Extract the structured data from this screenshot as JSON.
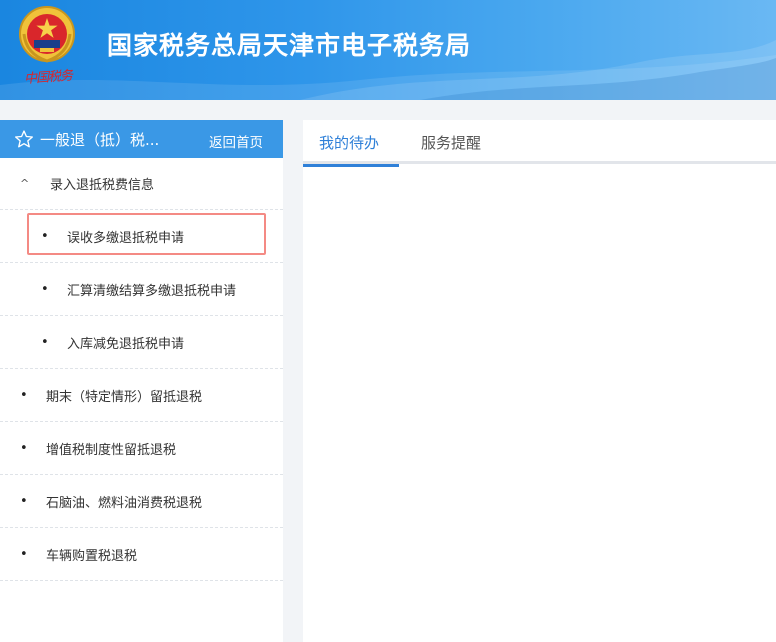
{
  "header": {
    "title": "国家税务总局天津市电子税务局",
    "signature": "中国税务",
    "emblem_icon": "tax-emblem-icon",
    "brand_color": "#1a86e0"
  },
  "sidebar": {
    "title": "一般退（抵）税...",
    "home_label": "返回首页",
    "star_icon": "star-icon",
    "group": {
      "marker": "^",
      "label": "录入退抵税费信息",
      "items": [
        {
          "label": "误收多缴退抵税申请"
        },
        {
          "label": "汇算清缴结算多缴退抵税申请"
        },
        {
          "label": "入库减免退抵税申请"
        }
      ]
    },
    "items": [
      {
        "label": "期末（特定情形）留抵退税"
      },
      {
        "label": "增值税制度性留抵退税"
      },
      {
        "label": "石脑油、燃料油消费税退税"
      },
      {
        "label": "车辆购置税退税"
      }
    ],
    "bullet": "•",
    "highlight_color": "#f48a84"
  },
  "main": {
    "tabs": [
      {
        "label": "我的待办",
        "active": true
      },
      {
        "label": "服务提醒",
        "active": false
      }
    ],
    "accent": "#2f80d8"
  }
}
